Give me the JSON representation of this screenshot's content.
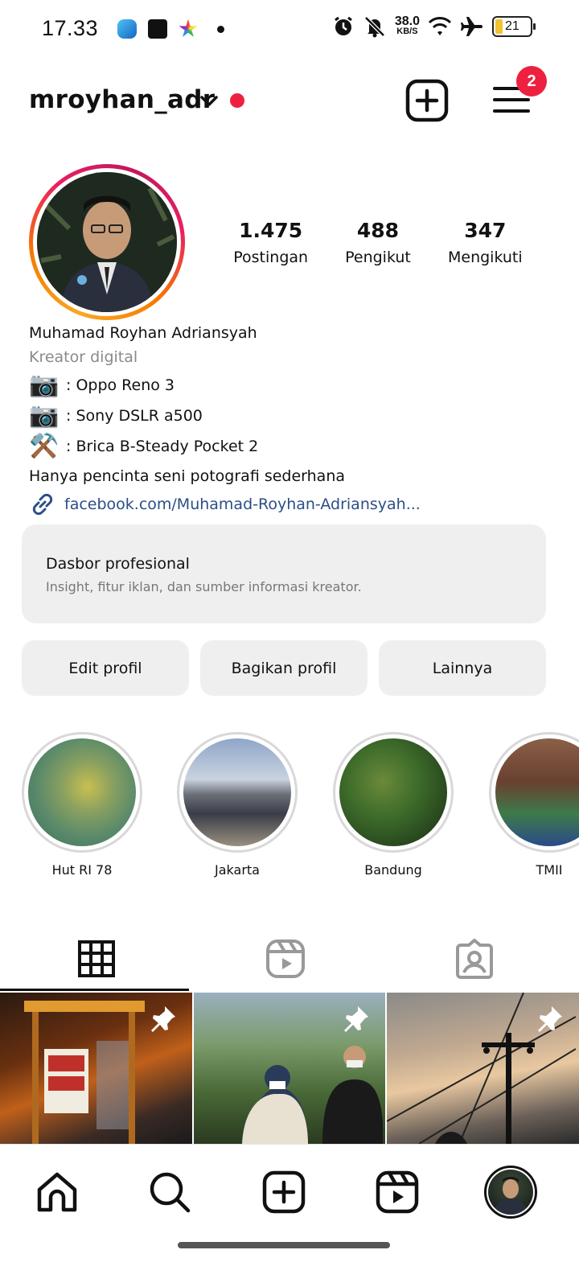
{
  "status_bar": {
    "time": "17.33",
    "speed_value": "38.0",
    "speed_unit": "KB/S",
    "battery": "21",
    "app_icons": [
      "telegram-icon",
      "shopee-icon",
      "star-app-icon"
    ]
  },
  "header": {
    "username": "mroyhan_adr",
    "notification_count": "2"
  },
  "profile": {
    "stats": [
      {
        "value": "1.475",
        "label": "Postingan"
      },
      {
        "value": "488",
        "label": "Pengikut"
      },
      {
        "value": "347",
        "label": "Mengikuti"
      }
    ],
    "full_name": "Muhamad Royhan Adriansyah",
    "category": "Kreator digital",
    "bio_lines": [
      {
        "emoji": "📷",
        "text": ": Oppo Reno 3"
      },
      {
        "emoji": "📷",
        "text": ": Sony DSLR a500"
      },
      {
        "emoji": "⚒️",
        "text": ": Brica B-Steady Pocket 2"
      }
    ],
    "tagline": "Hanya pencinta seni potografi sederhana",
    "link": "facebook.com/Muhamad-Royhan-Adriansyah..."
  },
  "dashboard": {
    "title": "Dasbor profesional",
    "subtitle": "Insight, fitur iklan, dan sumber informasi kreator."
  },
  "buttons": {
    "edit": "Edit profil",
    "share": "Bagikan profil",
    "more": "Lainnya"
  },
  "highlights": [
    {
      "label": "Hut RI 78"
    },
    {
      "label": "Jakarta"
    },
    {
      "label": "Bandung"
    },
    {
      "label": "TMII"
    }
  ],
  "tabs": [
    "grid-icon",
    "reels-icon",
    "tagged-icon"
  ],
  "colors": {
    "accent_red": "#ee2040",
    "link_blue": "#2b4e88",
    "button_grey": "#efefef"
  }
}
